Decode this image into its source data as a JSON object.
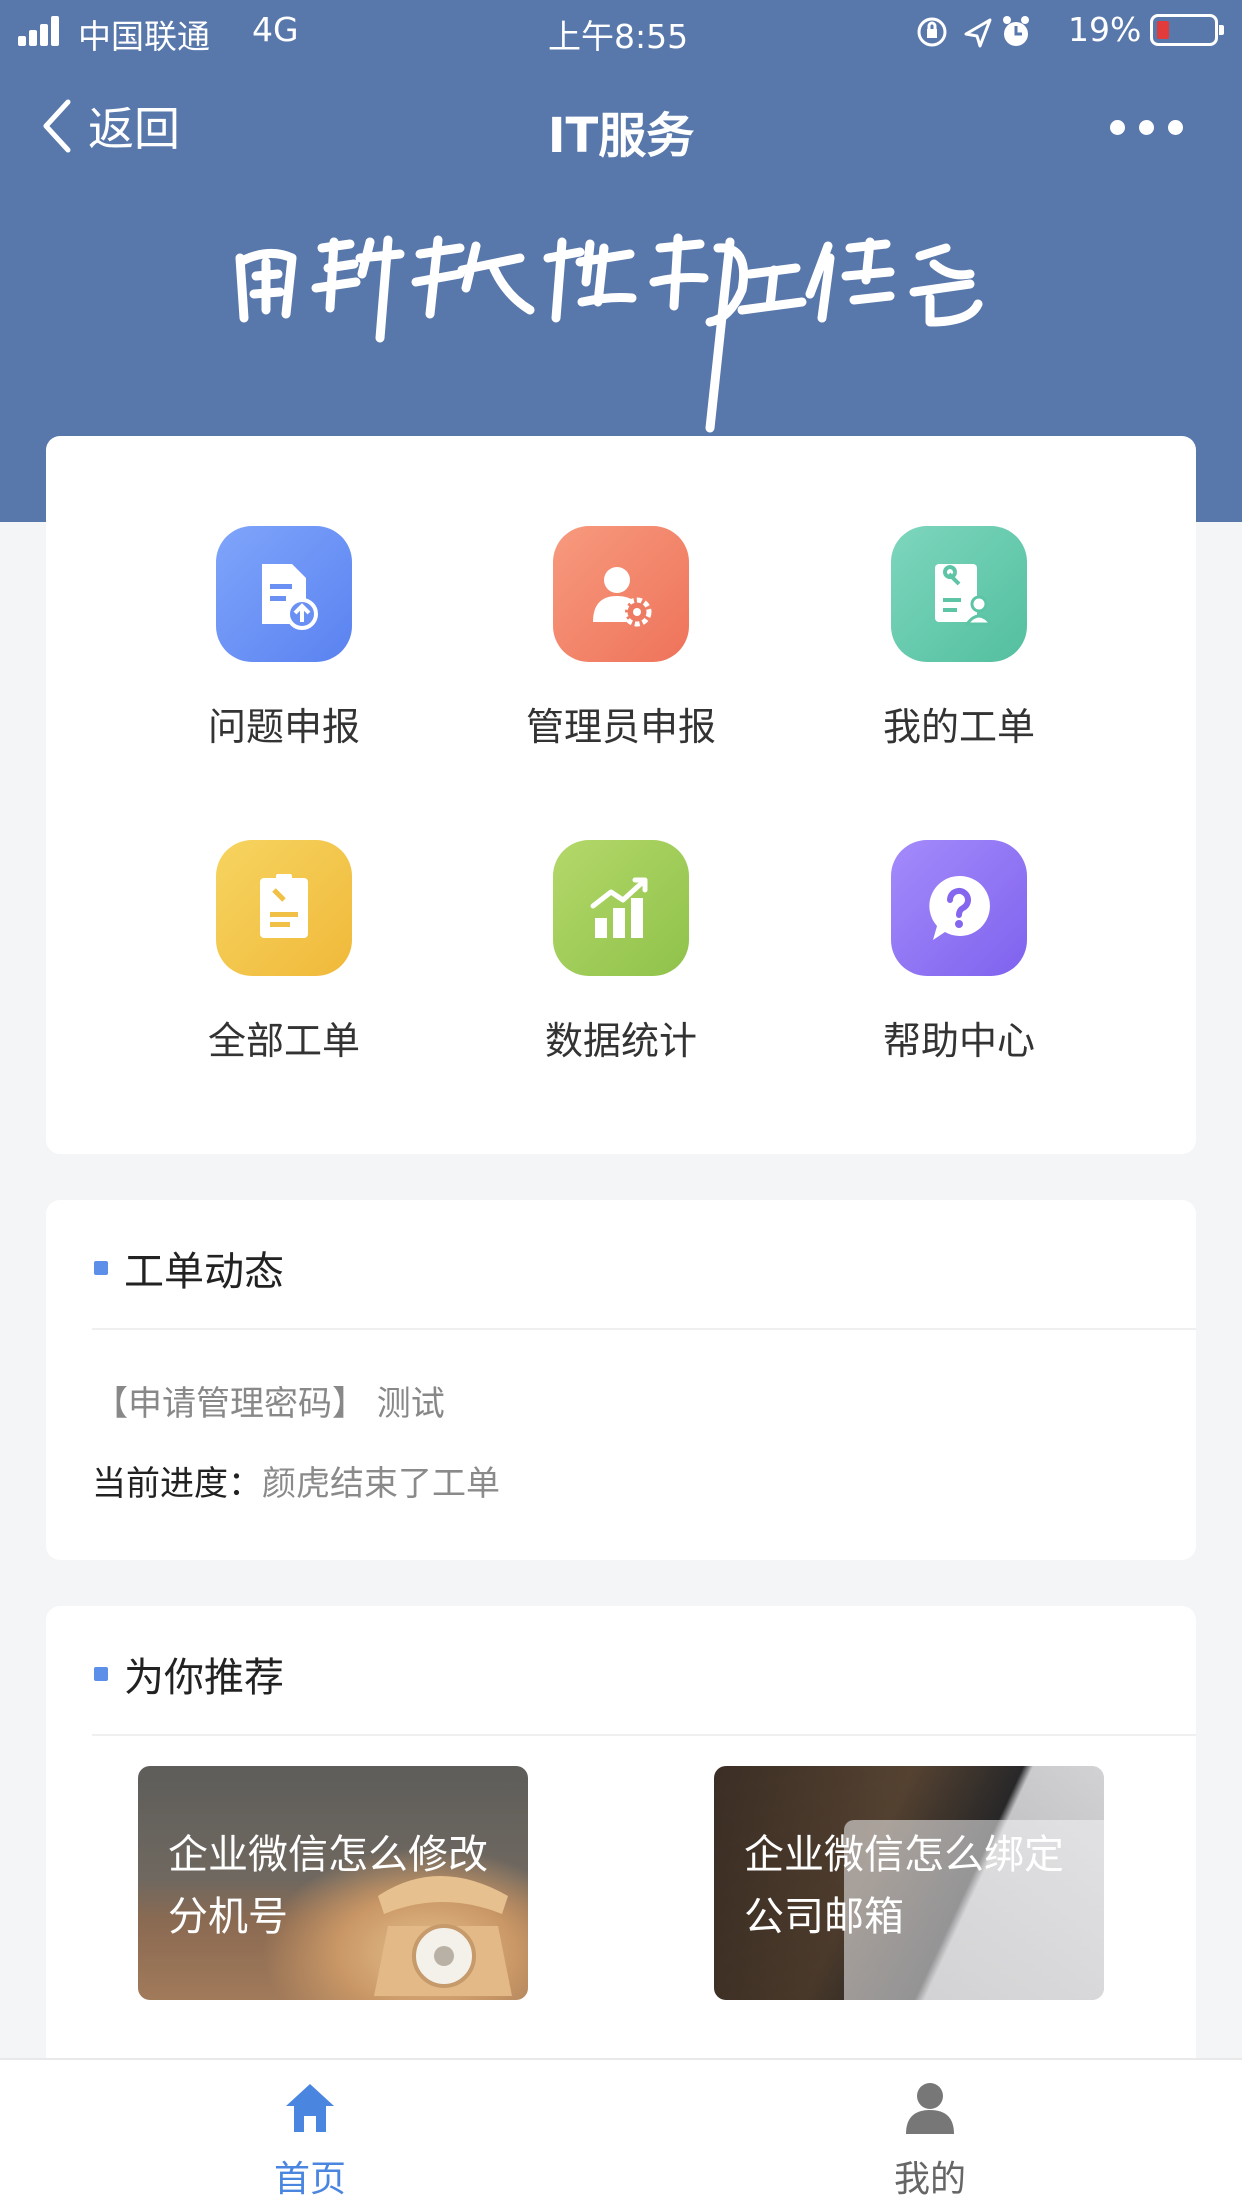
{
  "status_bar": {
    "carrier": "中国联通",
    "network": "4G",
    "time": "上午8:55",
    "battery_percent": "19%",
    "battery_level": 0.19,
    "icons": [
      "orientation-lock-icon",
      "location-arrow-icon",
      "alarm-icon"
    ]
  },
  "nav": {
    "back_label": "返回",
    "title": "IT服务",
    "more_icon": "more-dots-icon"
  },
  "banner": {
    "calligraphy_text": "用科技推动工作智能"
  },
  "colors": {
    "header_bg": "#5877ab",
    "accent": "#4a86e0",
    "section_marker": "#5b8fe8"
  },
  "menu": [
    {
      "label": "问题申报",
      "icon": "report-upload-icon",
      "color_from": "#7fa5fb",
      "color_to": "#5a82f0"
    },
    {
      "label": "管理员申报",
      "icon": "admin-gear-icon",
      "color_from": "#f79a7e",
      "color_to": "#ee735a"
    },
    {
      "label": "我的工单",
      "icon": "my-ticket-icon",
      "color_from": "#7dd6bd",
      "color_to": "#53bf9f"
    },
    {
      "label": "全部工单",
      "icon": "all-tickets-icon",
      "color_from": "#f6d460",
      "color_to": "#f0b93a"
    },
    {
      "label": "数据统计",
      "icon": "bar-chart-icon",
      "color_from": "#b4d86a",
      "color_to": "#8fc24a"
    },
    {
      "label": "帮助中心",
      "icon": "help-question-icon",
      "color_from": "#a48bfb",
      "color_to": "#7f62ee"
    }
  ],
  "ticket_section": {
    "title": "工单动态",
    "ticket_title": "【申请管理密码】 测试",
    "progress_label": "当前进度：",
    "progress_value": "颜虎结束了工单"
  },
  "recommend_section": {
    "title": "为你推荐",
    "items": [
      {
        "text": "企业微信怎么修改分机号",
        "image": "telephone-photo"
      },
      {
        "text": "企业微信怎么绑定公司邮箱",
        "image": "laptop-mail-photo"
      }
    ]
  },
  "tabbar": {
    "items": [
      {
        "label": "首页",
        "icon": "home-icon",
        "active": true
      },
      {
        "label": "我的",
        "icon": "user-icon",
        "active": false
      }
    ]
  }
}
